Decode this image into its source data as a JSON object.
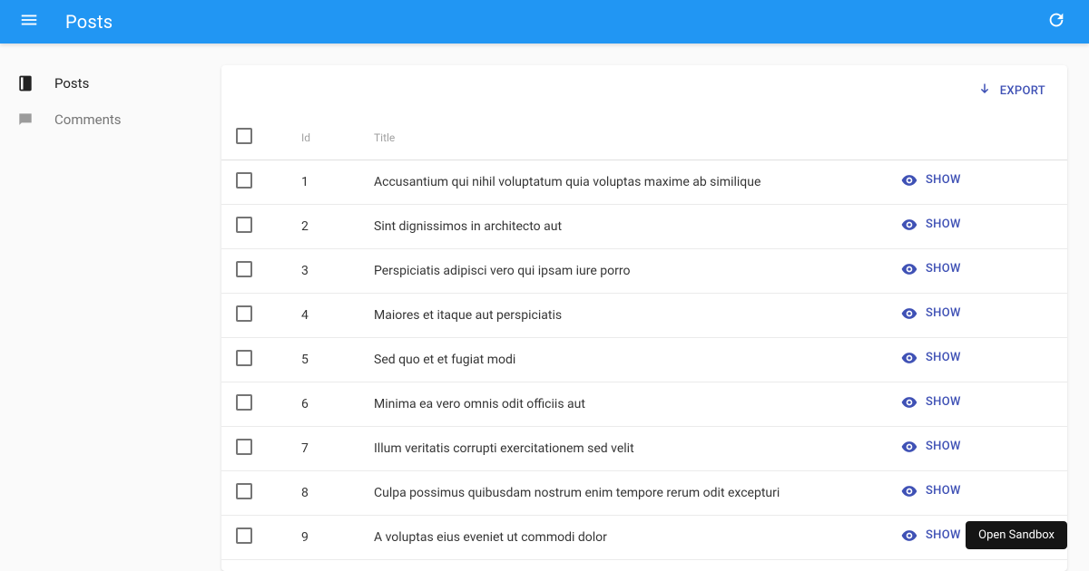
{
  "appbar": {
    "title": "Posts",
    "menu_icon": "menu",
    "refresh_icon": "refresh"
  },
  "sidebar": {
    "items": [
      {
        "label": "Posts",
        "icon": "book",
        "active": true
      },
      {
        "label": "Comments",
        "icon": "comment",
        "active": false
      }
    ]
  },
  "toolbar": {
    "export_label": "Export",
    "export_icon": "download"
  },
  "table": {
    "columns": {
      "id": "Id",
      "title": "Title"
    },
    "row_action_label": "Show",
    "row_action_icon": "eye",
    "rows": [
      {
        "id": "1",
        "title": "Accusantium qui nihil voluptatum quia voluptas maxime ab similique"
      },
      {
        "id": "2",
        "title": "Sint dignissimos in architecto aut"
      },
      {
        "id": "3",
        "title": "Perspiciatis adipisci vero qui ipsam iure porro"
      },
      {
        "id": "4",
        "title": "Maiores et itaque aut perspiciatis"
      },
      {
        "id": "5",
        "title": "Sed quo et et fugiat modi"
      },
      {
        "id": "6",
        "title": "Minima ea vero omnis odit officiis aut"
      },
      {
        "id": "7",
        "title": "Illum veritatis corrupti exercitationem sed velit"
      },
      {
        "id": "8",
        "title": "Culpa possimus quibusdam nostrum enim tempore rerum odit excepturi"
      },
      {
        "id": "9",
        "title": "A voluptas eius eveniet ut commodi dolor"
      }
    ]
  },
  "sandbox": {
    "label": "Open Sandbox"
  },
  "colors": {
    "primary": "#2196f3",
    "accent": "#3f51b5"
  }
}
